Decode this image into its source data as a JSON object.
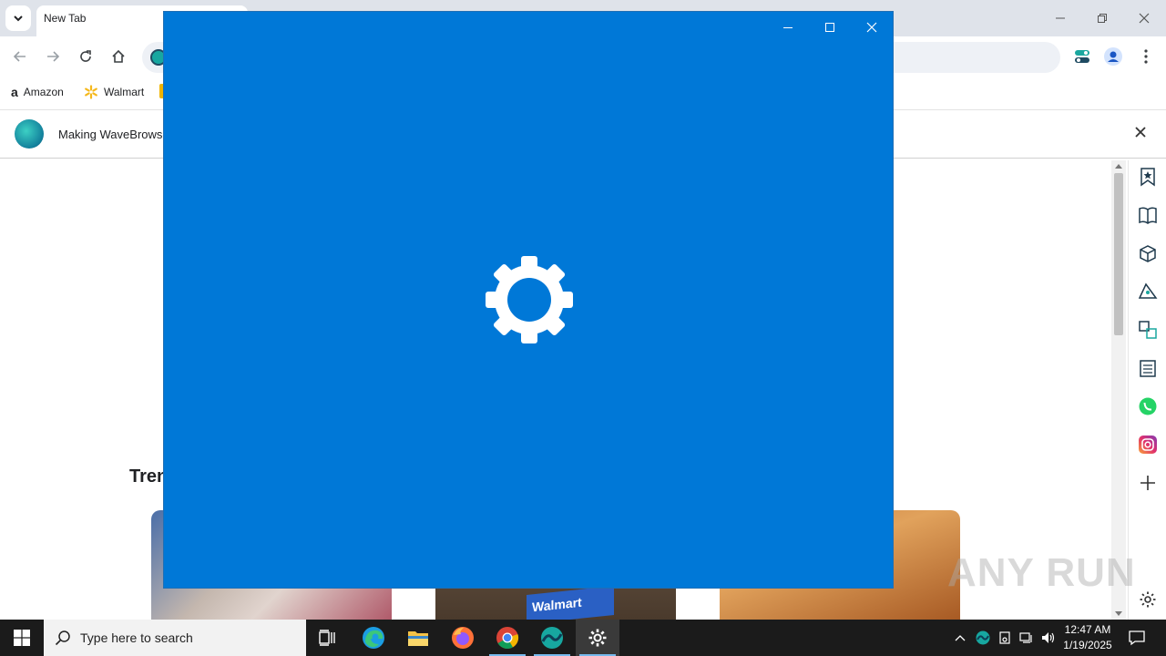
{
  "browser": {
    "tab_title": "New Tab",
    "bookmarks": [
      {
        "label": "Amazon",
        "icon": "amazon-icon"
      },
      {
        "label": "Walmart",
        "icon": "walmart-icon"
      }
    ],
    "infobar_text": "Making WaveBrowser"
  },
  "page": {
    "section_heading": "Tren",
    "card_walmart_text": "Walmart"
  },
  "side_panel": {
    "icons": [
      "bookmark-icon",
      "reading-list-icon",
      "package-icon",
      "shopping-tag-icon",
      "translate-icon",
      "notes-icon",
      "whatsapp-icon",
      "instagram-icon",
      "add-icon",
      "settings-icon"
    ]
  },
  "splash": {
    "app": "Settings",
    "background_color": "#0078d7"
  },
  "watermark": "ANY RUN",
  "taskbar": {
    "search_placeholder": "Type here to search",
    "time": "12:47 AM",
    "date": "1/19/2025",
    "apps": [
      "task-view-icon",
      "edge-icon",
      "file-explorer-icon",
      "firefox-icon",
      "chrome-icon",
      "wavebrowser-icon",
      "settings-icon"
    ]
  }
}
